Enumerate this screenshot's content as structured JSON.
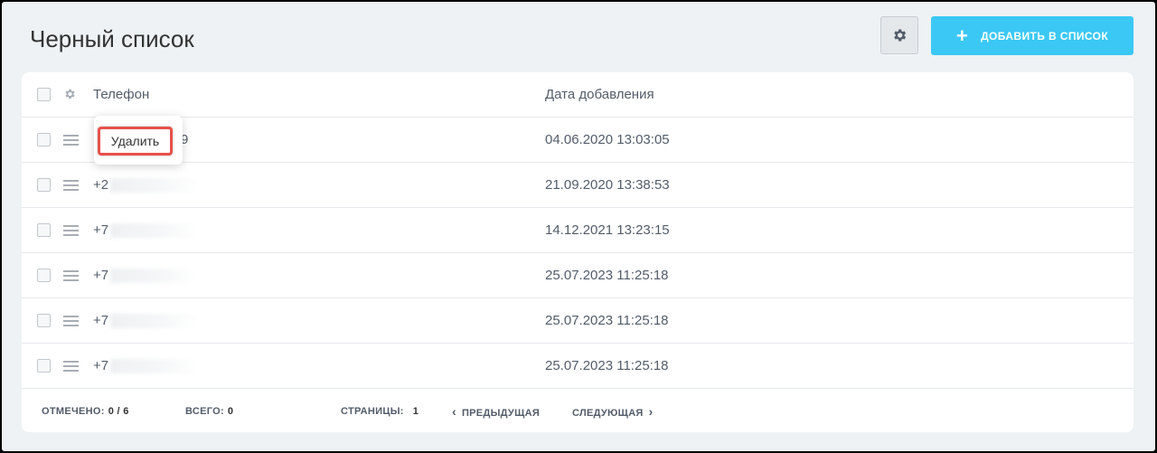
{
  "header": {
    "title": "Черный список",
    "add_label": "ДОБАВИТЬ В СПИСОК",
    "accent": "#3bc8f5"
  },
  "table": {
    "columns": [
      "Телефон",
      "Дата добавления"
    ],
    "rows": [
      {
        "phone": "+7",
        "phone_tail": "9",
        "date": "04.06.2020 13:03:05"
      },
      {
        "phone": "+2",
        "date": "21.09.2020 13:38:53"
      },
      {
        "phone": "+7",
        "date": "14.12.2021 13:23:15"
      },
      {
        "phone": "+7",
        "date": "25.07.2023 11:25:18"
      },
      {
        "phone": "+7",
        "date": "25.07.2023 11:25:18"
      },
      {
        "phone": "+7",
        "date": "25.07.2023 11:25:18"
      }
    ]
  },
  "context_menu": {
    "delete_label": "Удалить",
    "highlight_color": "#e8504a"
  },
  "footer": {
    "checked_label": "ОТМЕЧЕНО:",
    "checked_value": "0 / 6",
    "total_label": "ВСЕГО:",
    "total_value": "0",
    "pages_label": "СТРАНИЦЫ:",
    "pages_value": "1",
    "prev_label": "ПРЕДЫДУЩАЯ",
    "next_label": "СЛЕДУЮЩАЯ"
  },
  "icons": [
    "gear-icon",
    "plus-icon",
    "menu-icon",
    "chevron-left-icon",
    "chevron-right-icon"
  ]
}
